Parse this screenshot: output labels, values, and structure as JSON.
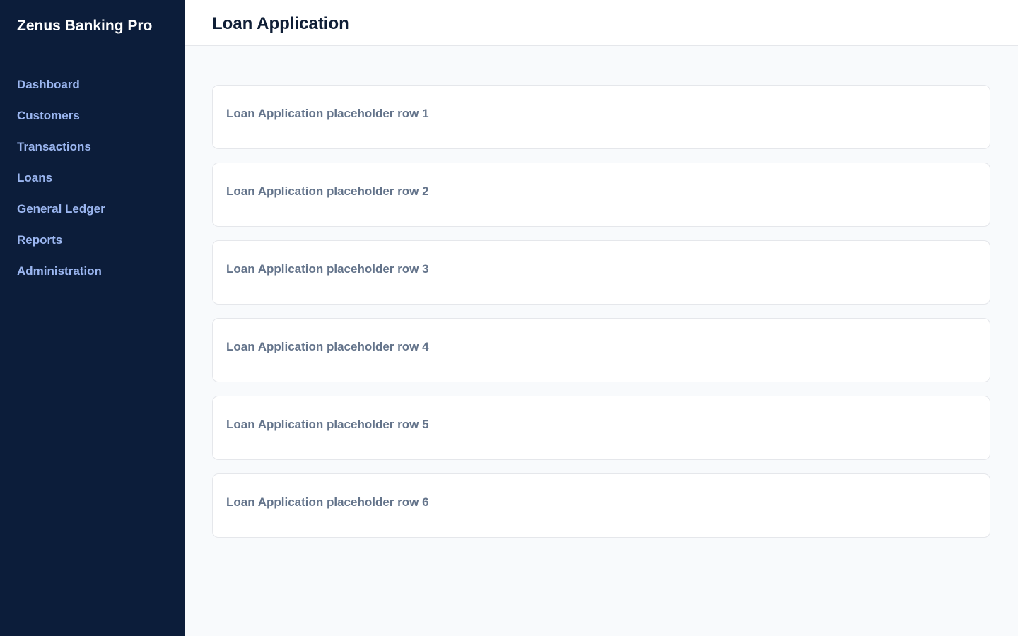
{
  "app": {
    "brand": "Zenus Banking Pro"
  },
  "sidebar": {
    "items": [
      {
        "label": "Dashboard"
      },
      {
        "label": "Customers"
      },
      {
        "label": "Transactions"
      },
      {
        "label": "Loans"
      },
      {
        "label": "General Ledger"
      },
      {
        "label": "Reports"
      },
      {
        "label": "Administration"
      }
    ]
  },
  "header": {
    "title": "Loan Application"
  },
  "main": {
    "rows": [
      {
        "label": "Loan Application placeholder row 1"
      },
      {
        "label": "Loan Application placeholder row 2"
      },
      {
        "label": "Loan Application placeholder row 3"
      },
      {
        "label": "Loan Application placeholder row 4"
      },
      {
        "label": "Loan Application placeholder row 5"
      },
      {
        "label": "Loan Application placeholder row 6"
      }
    ]
  },
  "colors": {
    "sidebar_bg": "#0c1d3a",
    "nav_text": "#9bb6f0",
    "brand_text": "#ffffff",
    "title_text": "#0f1e36",
    "row_text": "#64748b",
    "content_bg": "#f8fafc",
    "border": "#e5e7eb"
  }
}
